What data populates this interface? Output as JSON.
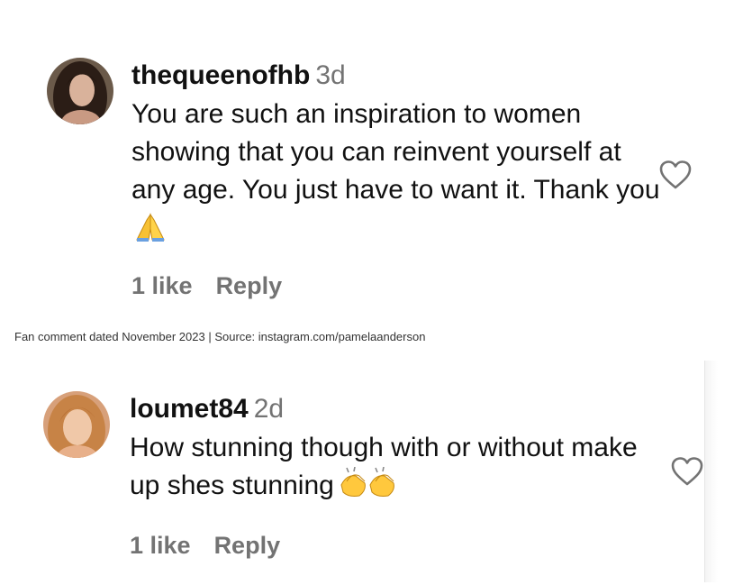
{
  "comments": [
    {
      "username": "thequeenofhb",
      "time": "3d",
      "text": "You are such an inspiration to women showing that you can reinvent yourself at any age. You just have to want it. Thank you",
      "emoji": "folded-hands",
      "likes": "1 like",
      "reply": "Reply",
      "avatar_icon": "avatar-dark-hair"
    },
    {
      "username": "loumet84",
      "time": "2d",
      "text": "How stunning though with or without make up shes stunning",
      "emoji": "clapping-hands",
      "likes": "1 like",
      "reply": "Reply",
      "avatar_icon": "avatar-blonde-hair"
    }
  ],
  "caption": "Fan comment dated November 2023 | Source: instagram.com/pamelaanderson",
  "colors": {
    "meta_gray": "#737373",
    "text": "#111111"
  }
}
